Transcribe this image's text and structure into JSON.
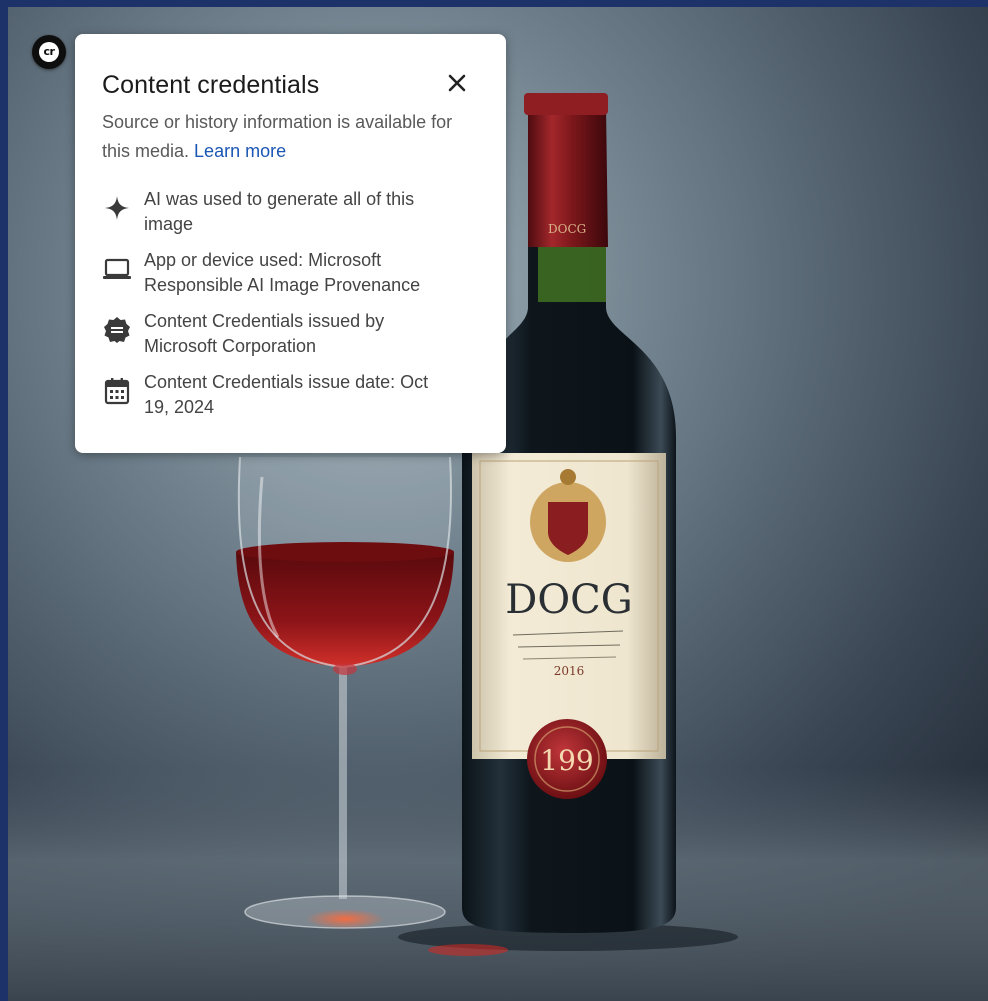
{
  "badge": {
    "label": "cr"
  },
  "popup": {
    "title": "Content credentials",
    "close_symbol": "×",
    "subtitle_text": "Source or history information is available for this media. ",
    "learn_more": "Learn more",
    "items": [
      {
        "icon": "sparkle-icon",
        "text": "AI was used to generate all of this image"
      },
      {
        "icon": "laptop-icon",
        "text": "App or device used: Microsoft Responsible AI Image Provenance"
      },
      {
        "icon": "seal-icon",
        "text": "Content Credentials issued by Microsoft Corporation"
      },
      {
        "icon": "calendar-icon",
        "text": "Content Credentials issue date: Oct 19, 2024"
      }
    ]
  },
  "image": {
    "label_main": "DOCG",
    "label_year": "2016",
    "seal_text": "199",
    "neck_text": "DOCG"
  },
  "colors": {
    "frame": "#1d3268",
    "link": "#1a56b3",
    "wine": "#7a0f12",
    "label_cream": "#efe6cf"
  }
}
